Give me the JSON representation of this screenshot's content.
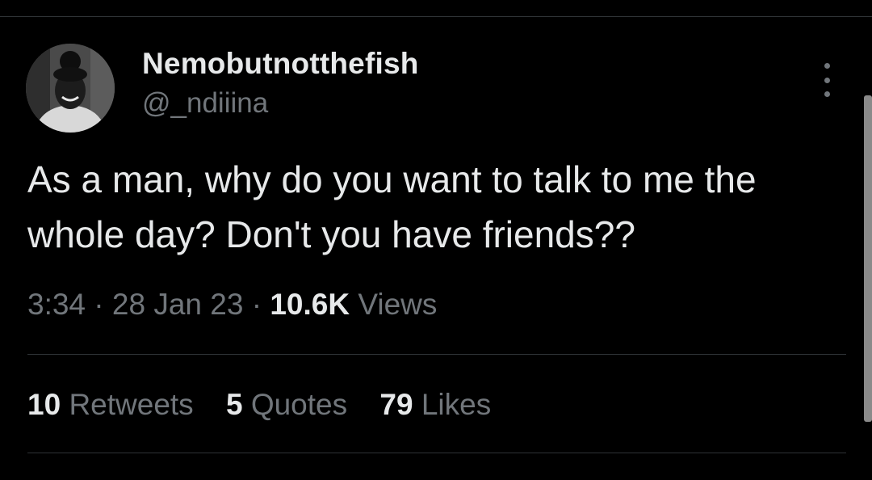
{
  "author": {
    "display_name": "Nemobutnotthefish",
    "handle": "@_ndiiina",
    "avatar": "profile-photo"
  },
  "tweet": {
    "text": "As a man, why do you want to talk to me the whole day? Don't you have friends??",
    "time": "3:34",
    "separator": "·",
    "date": "28 Jan 23",
    "views_count": "10.6K",
    "views_label": "Views"
  },
  "stats": {
    "retweets_count": "10",
    "retweets_label": "Retweets",
    "quotes_count": "5",
    "quotes_label": "Quotes",
    "likes_count": "79",
    "likes_label": "Likes"
  },
  "icons": {
    "more": "more-vertical-icon"
  },
  "colors": {
    "background": "#000000",
    "primary_text": "#e7e9ea",
    "secondary_text": "#71767b",
    "divider": "#2f3336"
  }
}
